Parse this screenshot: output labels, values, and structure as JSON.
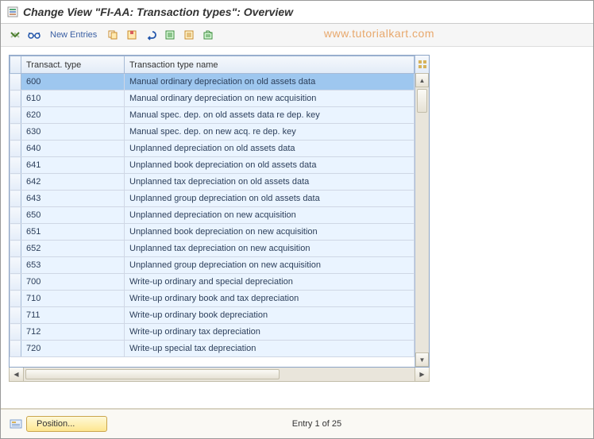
{
  "header": {
    "title": "Change View \"FI-AA: Transaction types\": Overview"
  },
  "toolbar": {
    "new_entries_label": "New Entries"
  },
  "watermark": "www.tutorialkart.com",
  "table": {
    "columns": {
      "c0": "Transact. type",
      "c1": "Transaction type name"
    },
    "rows": [
      {
        "code": "600",
        "name": "Manual ordinary depreciation on old assets data",
        "selected": true
      },
      {
        "code": "610",
        "name": "Manual ordinary depreciation on new acquisition"
      },
      {
        "code": "620",
        "name": "Manual spec. dep. on old assets data re dep. key"
      },
      {
        "code": "630",
        "name": "Manual spec. dep. on new acq. re dep. key"
      },
      {
        "code": "640",
        "name": "Unplanned depreciation on old assets data"
      },
      {
        "code": "641",
        "name": "Unplanned book depreciation on old assets data"
      },
      {
        "code": "642",
        "name": "Unplanned tax depreciation on old assets data"
      },
      {
        "code": "643",
        "name": "Unplanned group depreciation on old assets data"
      },
      {
        "code": "650",
        "name": "Unplanned depreciation on new acquisition"
      },
      {
        "code": "651",
        "name": "Unplanned book depreciation on new acquisition"
      },
      {
        "code": "652",
        "name": "Unplanned tax depreciation on new acquisition"
      },
      {
        "code": "653",
        "name": "Unplanned group depreciation on new acquisition"
      },
      {
        "code": "700",
        "name": "Write-up ordinary and special depreciation"
      },
      {
        "code": "710",
        "name": "Write-up ordinary book and tax depreciation"
      },
      {
        "code": "711",
        "name": "Write-up ordinary book depreciation"
      },
      {
        "code": "712",
        "name": "Write-up ordinary tax depreciation"
      },
      {
        "code": "720",
        "name": "Write-up special tax depreciation"
      }
    ]
  },
  "footer": {
    "position_label": "Position...",
    "status": "Entry 1 of 25"
  }
}
